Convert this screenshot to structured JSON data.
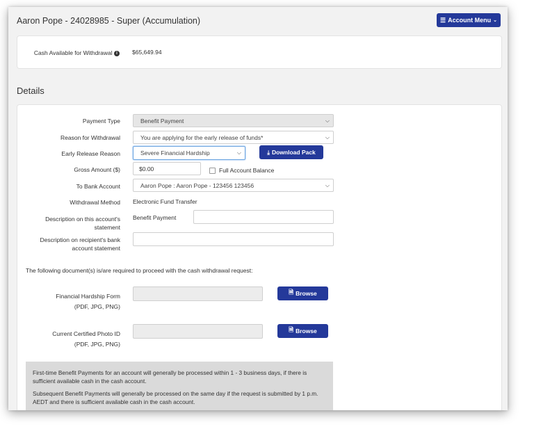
{
  "header": {
    "title": "Aaron Pope - 24028985 - Super (Accumulation)",
    "account_menu_label": "Account Menu"
  },
  "summary": {
    "cash_label": "Cash Available for Withdrawal",
    "cash_value": "$65,649.94"
  },
  "section_title": "Details",
  "form": {
    "payment_type": {
      "label": "Payment Type",
      "value": "Benefit Payment"
    },
    "reason": {
      "label": "Reason for Withdrawal",
      "value": "You are applying for the early release of funds*"
    },
    "early_release": {
      "label": "Early Release Reason",
      "value": "Severe Financial Hardship"
    },
    "download_label": "Download Pack",
    "gross_amount": {
      "label": "Gross Amount ($)",
      "value": "$0.00"
    },
    "full_balance_label": "Full Account Balance",
    "bank_account": {
      "label": "To Bank Account",
      "value": "Aaron Pope : Aaron Pope - 123456 123456"
    },
    "withdrawal_method": {
      "label": "Withdrawal Method",
      "value": "Electronic Fund Transfer"
    },
    "desc_account": {
      "label_1": "Description on this account's",
      "label_2": "statement",
      "prefix": "Benefit Payment",
      "value": ""
    },
    "desc_recipient": {
      "label_1": "Description on recipient's bank",
      "label_2": "account statement",
      "value": ""
    }
  },
  "documents": {
    "intro": "The following document(s) is/are required to proceed with the cash withdrawal request:",
    "hardship_form": {
      "label": "Financial Hardship Form",
      "formats": "(PDF, JPG, PNG)"
    },
    "photo_id": {
      "label": "Current Certified Photo ID",
      "formats": "(PDF, JPG, PNG)"
    },
    "browse_label": "Browse"
  },
  "notice": {
    "para1": "First-time Benefit Payments for an account will generally be processed within 1 - 3 business days, if there is sufficient available cash in the cash account.",
    "para2": "Subsequent Benefit Payments will generally be processed on the same day if the request is submitted by 1 p.m. AEDT and there is sufficient available cash in the cash account."
  }
}
